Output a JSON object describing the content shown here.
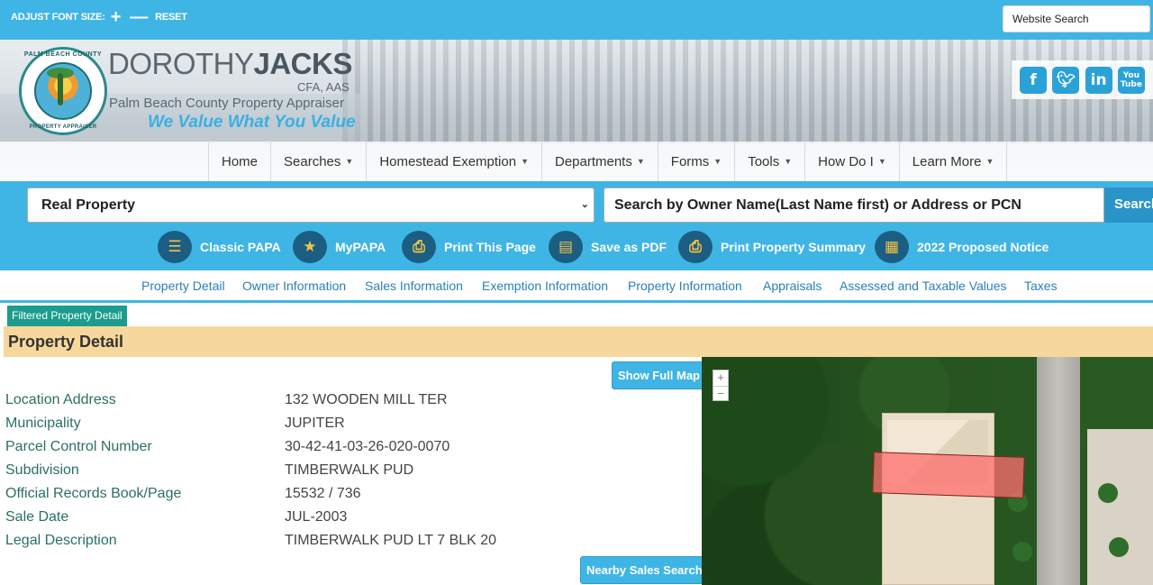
{
  "topbar": {
    "font_size_label": "ADJUST FONT SIZE:",
    "reset_label": "RESET",
    "website_search_placeholder": "Website Search"
  },
  "header": {
    "name_first": "DOROTHY",
    "name_last": "JACKS",
    "credentials": "CFA, AAS",
    "subtitle": "Palm Beach County Property Appraiser",
    "tagline": "We Value What You Value",
    "seal_top": "PALM BEACH COUNTY",
    "seal_bottom": "PROPERTY APPRAISER",
    "social": [
      "facebook-icon",
      "twitter-icon",
      "linkedin-icon",
      "youtube-icon"
    ],
    "youtube_label": "You Tube"
  },
  "nav": {
    "items": [
      {
        "label": "Home",
        "dropdown": false
      },
      {
        "label": "Searches",
        "dropdown": true
      },
      {
        "label": "Homestead Exemption",
        "dropdown": true
      },
      {
        "label": "Departments",
        "dropdown": true
      },
      {
        "label": "Forms",
        "dropdown": true
      },
      {
        "label": "Tools",
        "dropdown": true
      },
      {
        "label": "How Do I",
        "dropdown": true
      },
      {
        "label": "Learn More",
        "dropdown": true
      }
    ]
  },
  "search": {
    "category_selected": "Real Property",
    "placeholder": "Search by Owner Name(Last Name first) or Address or PCN",
    "button_label": "Search"
  },
  "tools": [
    {
      "label": "Classic PAPA",
      "icon": "list-icon"
    },
    {
      "label": "MyPAPA",
      "icon": "star-icon"
    },
    {
      "label": "Print This Page",
      "icon": "printer-icon"
    },
    {
      "label": "Save as PDF",
      "icon": "pdf-icon"
    },
    {
      "label": "Print Property Summary",
      "icon": "printer-icon"
    },
    {
      "label": "2022 Proposed Notice",
      "icon": "document-icon"
    }
  ],
  "tabs": [
    "Property Detail",
    "Owner Information",
    "Sales Information",
    "Exemption Information",
    "Property Information",
    "Appraisals",
    "Assessed and Taxable Values",
    "Taxes"
  ],
  "filtered_label": "Filtered Property Detail",
  "section_title": "Property Detail",
  "buttons": {
    "show_full_map": "Show Full Map",
    "nearby_sales": "Nearby Sales Search"
  },
  "property": [
    {
      "label": "Location Address",
      "value": "132 WOODEN MILL TER"
    },
    {
      "label": "Municipality",
      "value": "JUPITER"
    },
    {
      "label": "Parcel Control Number",
      "value": "30-42-41-03-26-020-0070"
    },
    {
      "label": "Subdivision",
      "value": "TIMBERWALK PUD"
    },
    {
      "label": "Official Records Book/Page",
      "value": "15532 / 736"
    },
    {
      "label": "Sale Date",
      "value": "JUL-2003"
    },
    {
      "label": "Legal Description",
      "value": "TIMBERWALK PUD LT 7 BLK 20"
    }
  ],
  "map": {
    "zoom_in": "+",
    "zoom_out": "−"
  },
  "colors": {
    "brand_blue": "#3fb5e5",
    "dark_blue": "#1b5e82",
    "tab_link": "#2a7fba",
    "detail_bar": "#f7d89c",
    "filtered_badge": "#1c9c8c"
  }
}
